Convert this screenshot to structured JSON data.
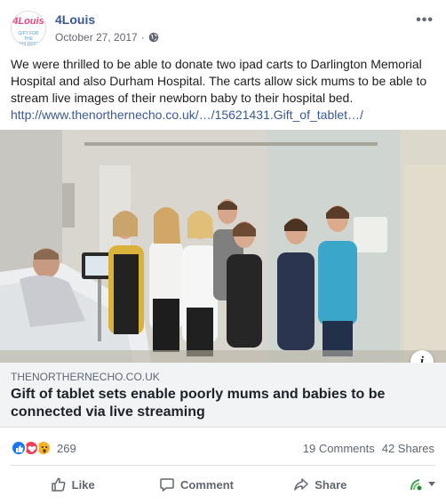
{
  "post": {
    "avatar_text_top": "4Louis",
    "avatar_text_bottom": "GIFT FOR THE CHILDREN",
    "author": "4Louis",
    "date": "October 27, 2017",
    "meta_separator": "·",
    "more_menu": "•••",
    "body": "We were thrilled to be able to donate two ipad carts to Darlington Memorial Hospital and also Durham Hospital. The carts allow sick mums to be able to stream live images of their newborn baby to their hospital bed.",
    "link": "http://www.thenorthernecho.co.uk/…/15621431.Gift_of_tablet…/"
  },
  "preview": {
    "info_glyph": "i",
    "domain": "THENORTHERNECHO.CO.UK",
    "headline": "Gift of tablet sets enable poorly mums and babies to be connected via live streaming"
  },
  "stats": {
    "reaction_count": "269",
    "comments": "19 Comments",
    "shares": "42 Shares"
  },
  "actions": {
    "like": "Like",
    "comment": "Comment",
    "share": "Share"
  },
  "colors": {
    "link": "#385898",
    "like": "#1877f2",
    "love": "#f33e58",
    "wow": "#f7b125",
    "preview_bg": "#f2f3f5"
  },
  "icons": [
    "globe-icon",
    "more-icon",
    "info-icon",
    "like-reaction-icon",
    "love-reaction-icon",
    "wow-reaction-icon",
    "like-icon",
    "comment-icon",
    "share-icon",
    "audience-icon",
    "chevron-down-icon"
  ]
}
